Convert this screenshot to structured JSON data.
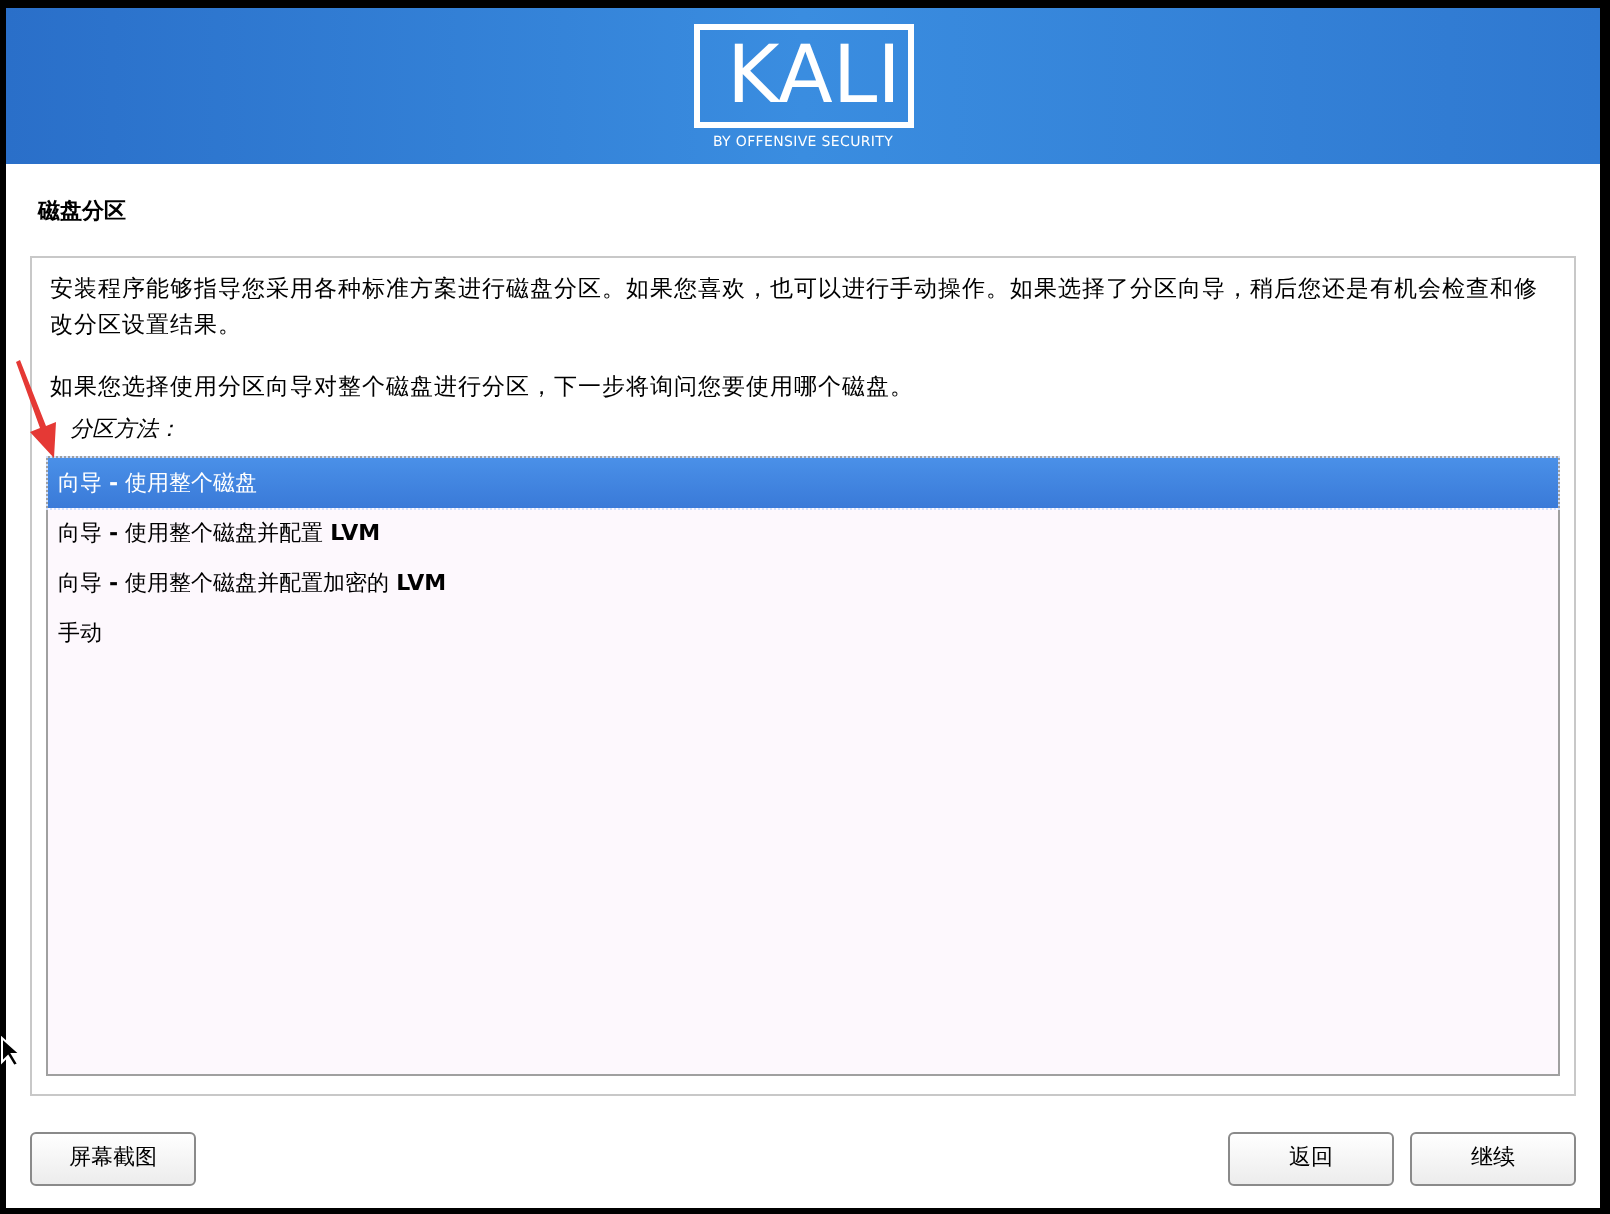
{
  "header": {
    "logo": {
      "text": "KALI",
      "tagline": "BY OFFENSIVE SECURITY"
    }
  },
  "page_title": "磁盘分区",
  "description": [
    "安装程序能够指导您采用各种标准方案进行磁盘分区。如果您喜欢，也可以进行手动操作。如果选择了分区向导，稍后您还是有机会检查和修改分区设置结果。",
    "如果您选择使用分区向导对整个磁盘进行分区，下一步将询问您要使用哪个磁盘。"
  ],
  "list_label": "分区方法：",
  "options": [
    {
      "label": "向导 **-** 使用整个磁盘",
      "selected": true
    },
    {
      "label": "向导 **-** 使用整个磁盘并配置 **LVM**",
      "selected": false
    },
    {
      "label": "向导 **-** 使用整个磁盘并配置加密的 **LVM**",
      "selected": false
    },
    {
      "label": "手动",
      "selected": false
    }
  ],
  "buttons": {
    "left": [
      "屏幕截图"
    ],
    "right": [
      "返回",
      "继续"
    ]
  }
}
